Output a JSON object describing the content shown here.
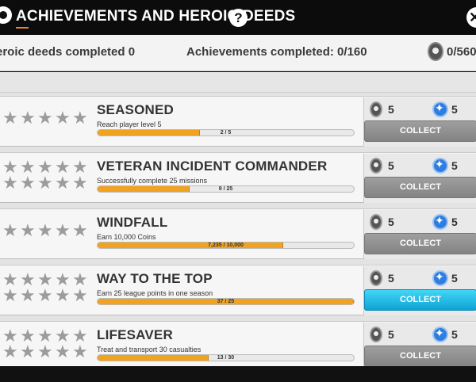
{
  "header": {
    "title": "ACHIEVEMENTS AND HEROIC DEEDS",
    "help_label": "?",
    "close_label": "✕"
  },
  "stats": {
    "heroic_deeds": "eroic deeds completed 0",
    "achievements": "Achievements completed: 0/160",
    "medals": "0/560"
  },
  "colors": {
    "accent_orange": "#f0a320",
    "collect_grey": "#939393",
    "collect_active": "#1bb8e6"
  },
  "achievements": [
    {
      "title": "SEASONED",
      "description": "Reach player level 5",
      "progress_text": "2 / 5",
      "progress": 0.4,
      "medal_reward": "5",
      "gem_reward": "5",
      "collect_label": "COLLECT",
      "active": false,
      "star_rows": 1
    },
    {
      "title": "VETERAN INCIDENT COMMANDER",
      "description": "Successfully complete 25 missions",
      "progress_text": "9 / 25",
      "progress": 0.36,
      "medal_reward": "5",
      "gem_reward": "5",
      "collect_label": "COLLECT",
      "active": false,
      "star_rows": 2
    },
    {
      "title": "WINDFALL",
      "description": "Earn 10,000 Coins",
      "progress_text": "7,235 / 10,000",
      "progress": 0.7235,
      "medal_reward": "5",
      "gem_reward": "5",
      "collect_label": "COLLECT",
      "active": false,
      "star_rows": 1
    },
    {
      "title": "WAY TO THE TOP",
      "description": "Earn 25 league points in one season",
      "progress_text": "37 / 25",
      "progress": 1.0,
      "medal_reward": "5",
      "gem_reward": "5",
      "collect_label": "COLLECT",
      "active": true,
      "star_rows": 2
    },
    {
      "title": "LIFESAVER",
      "description": "Treat and transport 30 casualties",
      "progress_text": "13 / 30",
      "progress": 0.4333,
      "medal_reward": "5",
      "gem_reward": "5",
      "collect_label": "COLLECT",
      "active": false,
      "star_rows": 2
    }
  ]
}
